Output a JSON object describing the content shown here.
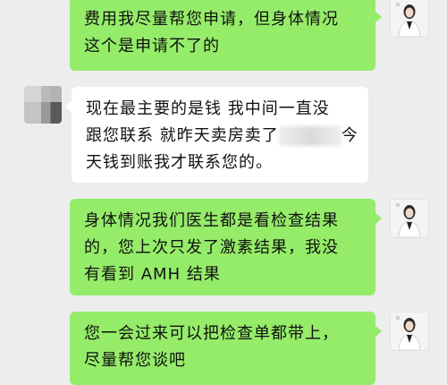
{
  "messages": [
    {
      "side": "me",
      "lines": [
        "费用我尽量帮您申请，但身体情况",
        "这个是申请不了的"
      ]
    },
    {
      "side": "other",
      "lines": [
        "现在最主要的是钱 我中间一直没",
        "跟您联系 就昨天卖房卖了",
        "今",
        "天钱到账我才联系您的。"
      ]
    },
    {
      "side": "me",
      "lines": [
        "身体情况我们医生都是看检查结果",
        "的，您上次只发了激素结果，我没",
        "有看到 AMH 结果"
      ]
    },
    {
      "side": "me",
      "lines": [
        "您一会过来可以把检查单都带上，",
        "尽量帮您谈吧"
      ]
    }
  ],
  "colors": {
    "background": "#ededed",
    "my_bubble": "#95ec69",
    "other_bubble": "#ffffff"
  },
  "icons": {
    "my_avatar": "doctor-avatar-icon",
    "other_avatar": "pixelated-avatar-icon"
  }
}
